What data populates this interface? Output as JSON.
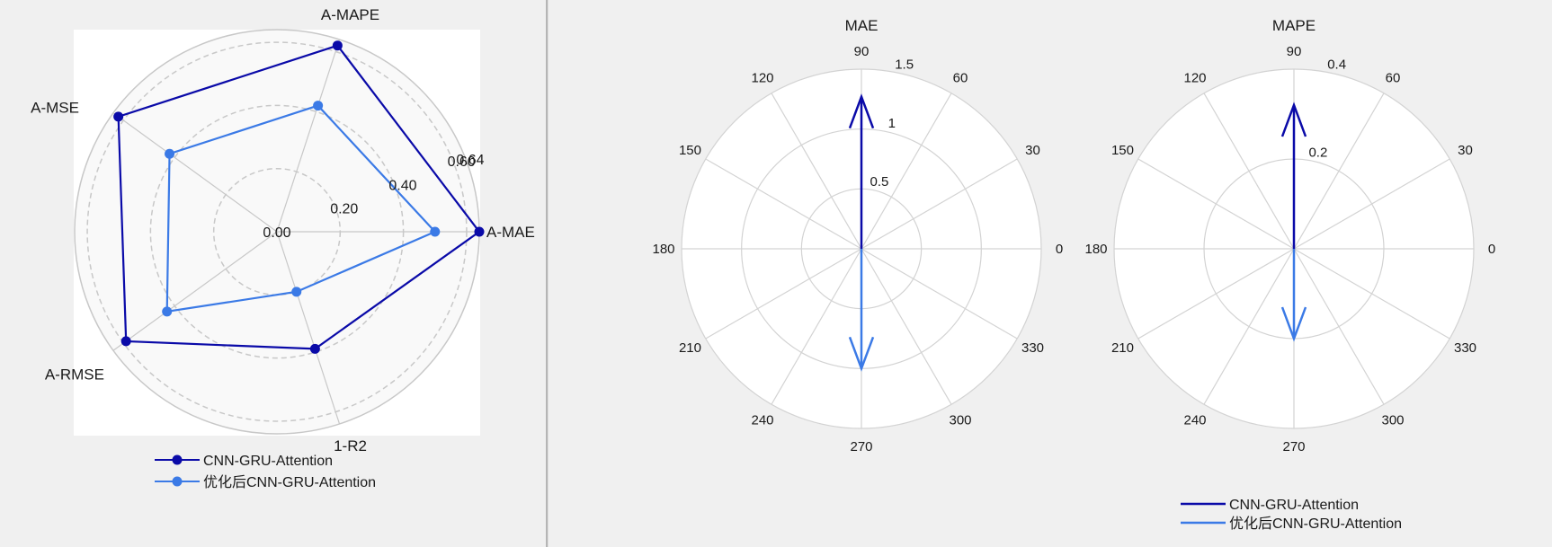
{
  "colors": {
    "series1": "#0a0aa8",
    "series2": "#3b7ae6",
    "grid": "#d3d3d3",
    "radar_bg": "#f9f9f9"
  },
  "chart_data": [
    {
      "type": "radar",
      "axes": [
        "A-MAE",
        "A-MAPE",
        "A-MSE",
        "A-RMSE",
        "1-R2"
      ],
      "radial_ticks": [
        0.0,
        0.2,
        0.4,
        0.6
      ],
      "radial_tick_labels": [
        "0.00",
        "0.20",
        "0.40",
        "0.60"
      ],
      "rmax": 0.64,
      "rmax_label": "0.64",
      "series": [
        {
          "name": "CNN-GRU-Attention",
          "values": [
            0.64,
            0.62,
            0.62,
            0.59,
            0.39
          ]
        },
        {
          "name": "优化后CNN-GRU-Attention",
          "values": [
            0.5,
            0.42,
            0.42,
            0.43,
            0.2
          ]
        }
      ],
      "legend_position": "bottom"
    },
    {
      "type": "compass",
      "title": "MAE",
      "angle_ticks": [
        0,
        30,
        60,
        90,
        120,
        150,
        180,
        210,
        240,
        270,
        300,
        330
      ],
      "radial_ticks": [
        0.5,
        1,
        1.5
      ],
      "radial_tick_labels": [
        "0.5",
        "1",
        "1.5"
      ],
      "rmax": 1.5,
      "series": [
        {
          "name": "CNN-GRU-Attention",
          "angle": 90,
          "value": 1.27
        },
        {
          "name": "优化后CNN-GRU-Attention",
          "angle": 270,
          "value": 1.0
        }
      ]
    },
    {
      "type": "compass",
      "title": "MAPE",
      "angle_ticks": [
        0,
        30,
        60,
        90,
        120,
        150,
        180,
        210,
        240,
        270,
        300,
        330
      ],
      "radial_ticks": [
        0.2,
        0.4
      ],
      "radial_tick_labels": [
        "0.2",
        "0.4"
      ],
      "rmax": 0.4,
      "series": [
        {
          "name": "CNN-GRU-Attention",
          "angle": 90,
          "value": 0.32
        },
        {
          "name": "优化后CNN-GRU-Attention",
          "angle": 270,
          "value": 0.2
        }
      ]
    }
  ],
  "legend_right": {
    "items": [
      "CNN-GRU-Attention",
      "优化后CNN-GRU-Attention"
    ]
  }
}
